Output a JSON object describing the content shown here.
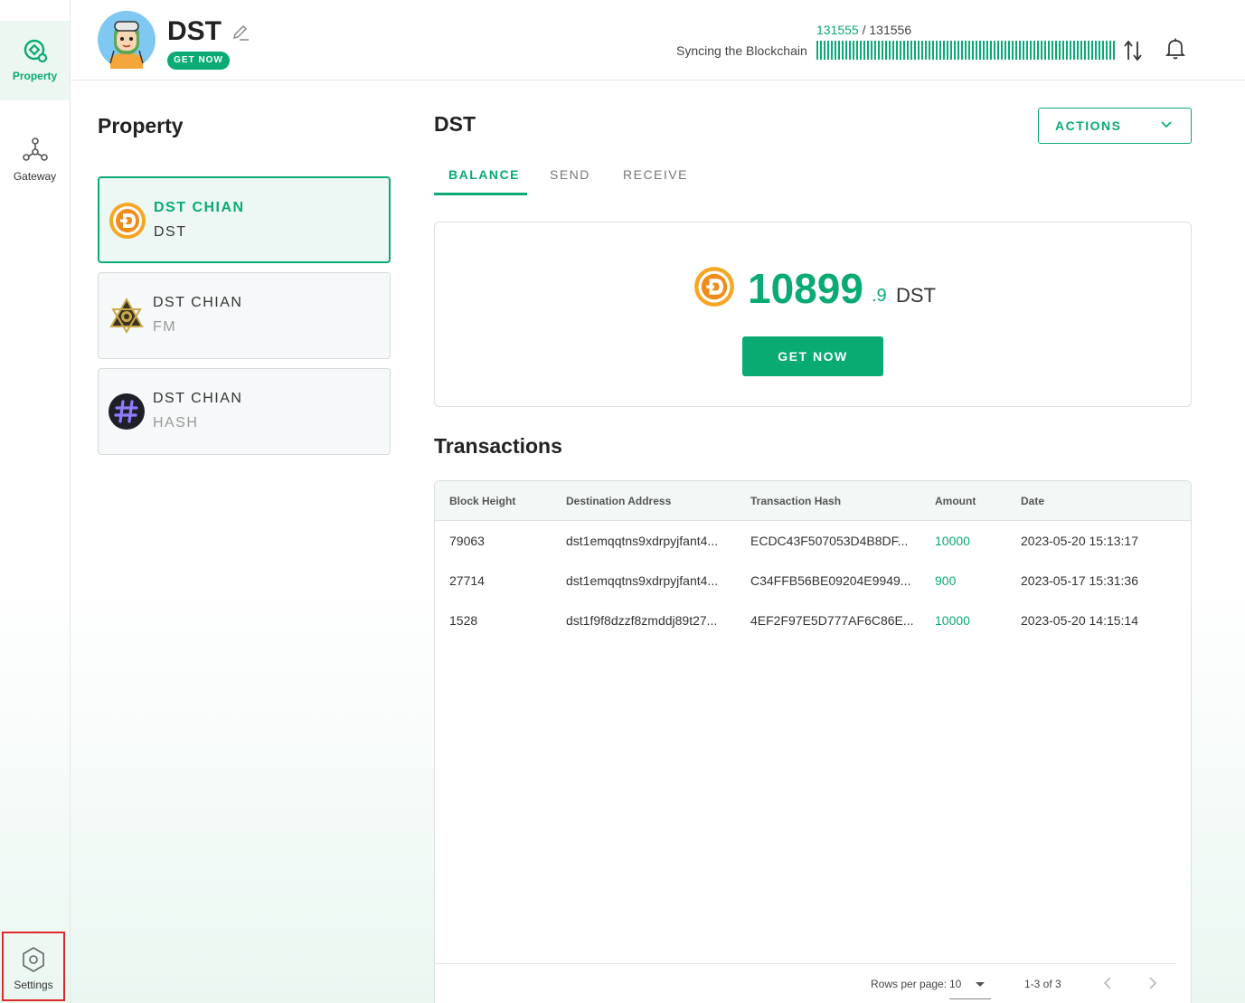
{
  "sidebar": {
    "items": [
      {
        "label": "Property",
        "icon": "property-icon",
        "active": true
      },
      {
        "label": "Gateway",
        "icon": "gateway-icon",
        "active": false
      }
    ],
    "settings": {
      "label": "Settings",
      "icon": "settings-icon"
    }
  },
  "header": {
    "wallet_name": "DST",
    "badge": "GET NOW",
    "sync": {
      "current": "131555",
      "separator": " / ",
      "total": "131556",
      "label": "Syncing the Blockchain",
      "progress": 0.99999
    }
  },
  "property": {
    "title": "Property",
    "assets": [
      {
        "chain": "DST CHIAN",
        "symbol": "DST",
        "active": true
      },
      {
        "chain": "DST CHIAN",
        "symbol": "FM",
        "active": false
      },
      {
        "chain": "DST CHIAN",
        "symbol": "HASH",
        "active": false
      }
    ]
  },
  "main": {
    "title": "DST",
    "actions_label": "ACTIONS",
    "tabs": [
      {
        "label": "BALANCE",
        "active": true
      },
      {
        "label": "SEND",
        "active": false
      },
      {
        "label": "RECEIVE",
        "active": false
      }
    ],
    "balance": {
      "integer": "10899",
      "decimal": ".9",
      "unit": "DST",
      "button": "GET NOW"
    }
  },
  "transactions": {
    "title": "Transactions",
    "columns": [
      "Block Height",
      "Destination Address",
      "Transaction Hash",
      "Amount",
      "Date"
    ],
    "rows": [
      [
        "79063",
        "dst1emqqtns9xdrpyjfant4...",
        "ECDC43F507053D4B8DF...",
        "10000",
        "2023-05-20 15:13:17"
      ],
      [
        "27714",
        "dst1emqqtns9xdrpyjfant4...",
        "C34FFB56BE09204E9949...",
        "900",
        "2023-05-17 15:31:36"
      ],
      [
        "1528",
        "dst1f9f8dzzf8zmddj89t27...",
        "4EF2F97E5D777AF6C86E...",
        "10000",
        "2023-05-20 14:15:14"
      ]
    ],
    "footer": {
      "rows_per_page_label": "Rows per page:",
      "rows_per_page": "10",
      "range": "1-3 of 3"
    }
  },
  "colors": {
    "accent": "#0aaa73",
    "highlight_border": "#e02828"
  }
}
